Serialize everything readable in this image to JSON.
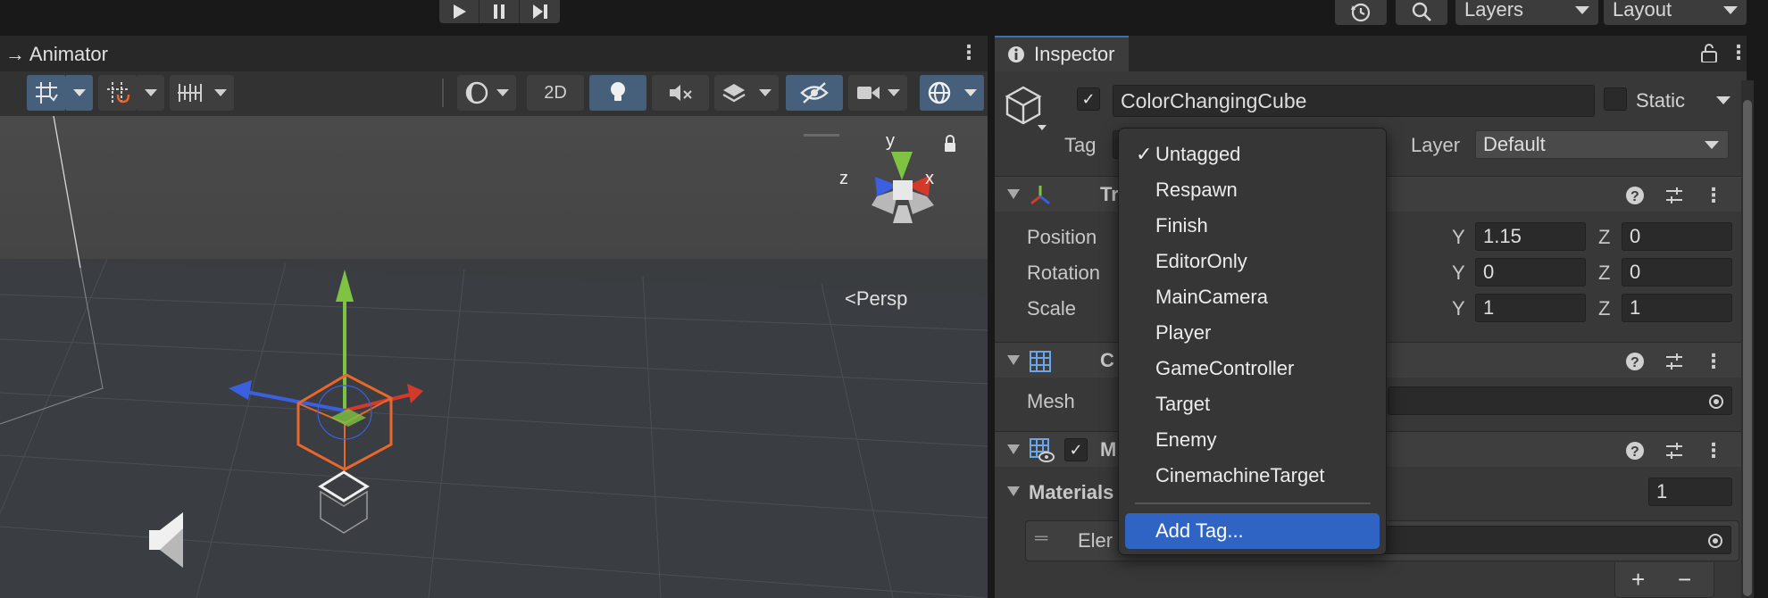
{
  "toolbar": {
    "play_icon": "play-icon",
    "pause_icon": "pause-icon",
    "step_icon": "step-icon",
    "history_icon": "history-icon",
    "search_icon": "search-icon",
    "layers_label": "Layers",
    "layout_label": "Layout"
  },
  "scene": {
    "tab_label": "Animator",
    "mode_2d": "2D",
    "projection_label": "Persp",
    "gizmo_axes": {
      "x": "x",
      "y": "y",
      "z": "z"
    }
  },
  "inspector": {
    "tab_label": "Inspector",
    "object_name": "ColorChangingCube",
    "active_checked": true,
    "static_label": "Static",
    "static_checked": false,
    "tag_label": "Tag",
    "layer_label": "Layer",
    "layer_value": "Default",
    "transform": {
      "title": "Tr",
      "rows": [
        {
          "label": "Position",
          "y": "1.15",
          "z": "0"
        },
        {
          "label": "Rotation",
          "y": "0",
          "z": "0"
        },
        {
          "label": "Scale",
          "y": "1",
          "z": "1"
        }
      ],
      "axis_y": "Y",
      "axis_z": "Z"
    },
    "mesh_filter": {
      "title": "C",
      "mesh_label": "Mesh"
    },
    "mesh_renderer": {
      "title": "M",
      "enabled": true,
      "materials_label": "Materials",
      "materials_count": "1",
      "element_label": "Eler"
    },
    "add_symbol": "+",
    "remove_symbol": "−"
  },
  "tag_menu": {
    "items": [
      {
        "label": "Untagged",
        "checked": true
      },
      {
        "label": "Respawn"
      },
      {
        "label": "Finish"
      },
      {
        "label": "EditorOnly"
      },
      {
        "label": "MainCamera"
      },
      {
        "label": "Player"
      },
      {
        "label": "GameController"
      },
      {
        "label": "Target"
      },
      {
        "label": "Enemy"
      },
      {
        "label": "CinemachineTarget"
      }
    ],
    "add_tag_label": "Add Tag...",
    "check_glyph": "✓"
  },
  "colors": {
    "accent": "#2f64c4",
    "active_button": "#46607c",
    "gizmo_x": "#d33a2c",
    "gizmo_y": "#7ec342",
    "gizmo_z": "#3a5fe0",
    "selection": "#e8672a"
  }
}
